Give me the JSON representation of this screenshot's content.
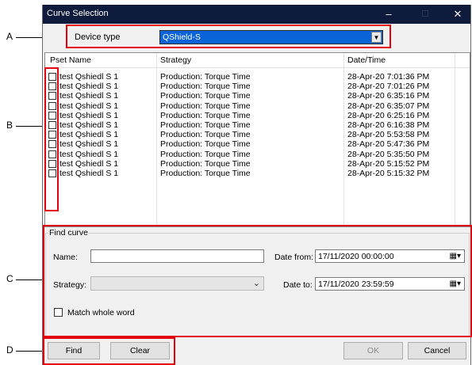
{
  "window": {
    "title": "Curve Selection",
    "minimize_glyph": "–",
    "maximize_glyph": "☐",
    "close_glyph": "✕"
  },
  "callouts": [
    "A",
    "B",
    "C",
    "D"
  ],
  "device": {
    "label": "Device type",
    "value": "QShield-S"
  },
  "list": {
    "columns": [
      "Pset Name",
      "Strategy",
      "Date/Time"
    ],
    "rows": [
      {
        "name": "test Qshiedl S 1",
        "strategy": "Production: Torque Time",
        "datetime": "28-Apr-20 7:01:36 PM"
      },
      {
        "name": "test Qshiedl S 1",
        "strategy": "Production: Torque Time",
        "datetime": "28-Apr-20 7:01:26 PM"
      },
      {
        "name": "test Qshiedl S 1",
        "strategy": "Production: Torque Time",
        "datetime": "28-Apr-20 6:35:16 PM"
      },
      {
        "name": "test Qshiedl S 1",
        "strategy": "Production: Torque Time",
        "datetime": "28-Apr-20 6:35:07 PM"
      },
      {
        "name": "test Qshiedl S 1",
        "strategy": "Production: Torque Time",
        "datetime": "28-Apr-20 6:25:16 PM"
      },
      {
        "name": "test Qshiedl S 1",
        "strategy": "Production: Torque Time",
        "datetime": "28-Apr-20 6:16:38 PM"
      },
      {
        "name": "test Qshiedl S 1",
        "strategy": "Production: Torque Time",
        "datetime": "28-Apr-20 5:53:58 PM"
      },
      {
        "name": "test Qshiedl S 1",
        "strategy": "Production: Torque Time",
        "datetime": "28-Apr-20 5:47:36 PM"
      },
      {
        "name": "test Qshiedl S 1",
        "strategy": "Production: Torque Time",
        "datetime": "28-Apr-20 5:35:50 PM"
      },
      {
        "name": "test Qshiedl S 1",
        "strategy": "Production: Torque Time",
        "datetime": "28-Apr-20 5:15:52 PM"
      },
      {
        "name": "test Qshiedl S 1",
        "strategy": "Production: Torque Time",
        "datetime": "28-Apr-20 5:15:32 PM"
      }
    ]
  },
  "find": {
    "group_title": "Find curve",
    "name_label": "Name:",
    "name_value": "",
    "strategy_label": "Strategy:",
    "strategy_value": "",
    "date_from_label": "Date from:",
    "date_from_value": "17/11/2020 00:00:00",
    "date_to_label": "Date to:",
    "date_to_value": "17/11/2020 23:59:59",
    "match_label": "Match whole word",
    "match_checked": false
  },
  "buttons": {
    "find": "Find",
    "clear": "Clear",
    "ok": "OK",
    "cancel": "Cancel",
    "ok_enabled": false
  },
  "colors": {
    "titlebar": "#0f1b3c",
    "selection": "#0a64d8",
    "highlight_box": "#e3000f"
  },
  "icons": {
    "dropdown": "chevron-down-icon",
    "calendar": "calendar-icon",
    "close": "close-icon",
    "minimize": "minimize-icon",
    "maximize": "maximize-icon"
  }
}
